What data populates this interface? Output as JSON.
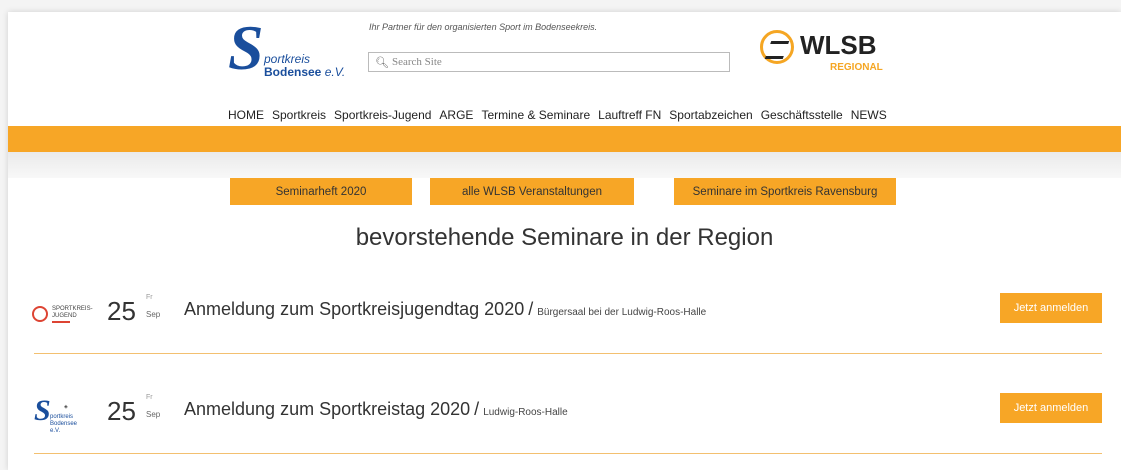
{
  "header": {
    "logo_sk": {
      "letter": "S",
      "line1": "portkreis",
      "line2": "Bodensee",
      "line2_suffix": "e.V."
    },
    "tagline": "Ihr Partner für den organisierten Sport im Bodenseekreis.",
    "search": {
      "placeholder": "Search Site",
      "icon": "search-icon"
    },
    "logo_wlsb": {
      "text": "WLSB",
      "sub": "REGIONAL"
    }
  },
  "nav": [
    "HOME",
    "Sportkreis",
    "Sportkreis-Jugend",
    "ARGE",
    "Termine & Seminare",
    "Lauftreff FN",
    "Sportabzeichen",
    "Geschäftsstelle",
    "NEWS"
  ],
  "ctas": [
    "Seminarheft 2020",
    "alle WLSB Veranstaltungen",
    "Seminare im Sportkreis Ravensburg"
  ],
  "heading": "bevorstehende Seminare in der Region",
  "events": [
    {
      "thumb": "jugend",
      "thumb_text": "SPORTKREIS-JUGEND",
      "day": "25",
      "dow": "Fr",
      "month": "Sep",
      "title": "Anmeldung zum Sportkreisjugendtag 2020",
      "sep": "/",
      "location": "Bürgersaal bei der Ludwig-Roos-Halle",
      "button": "Jetzt anmelden"
    },
    {
      "thumb": "sk",
      "thumb_text": "portkreis Bodensee e.V.",
      "day": "25",
      "dow": "Fr",
      "month": "Sep",
      "title": "Anmeldung zum Sportkreistag 2020",
      "sep": "/",
      "location": "Ludwig-Roos-Halle",
      "button": "Jetzt anmelden"
    }
  ],
  "colors": {
    "accent": "#f7a626",
    "brand_blue": "#1a4e9c"
  }
}
